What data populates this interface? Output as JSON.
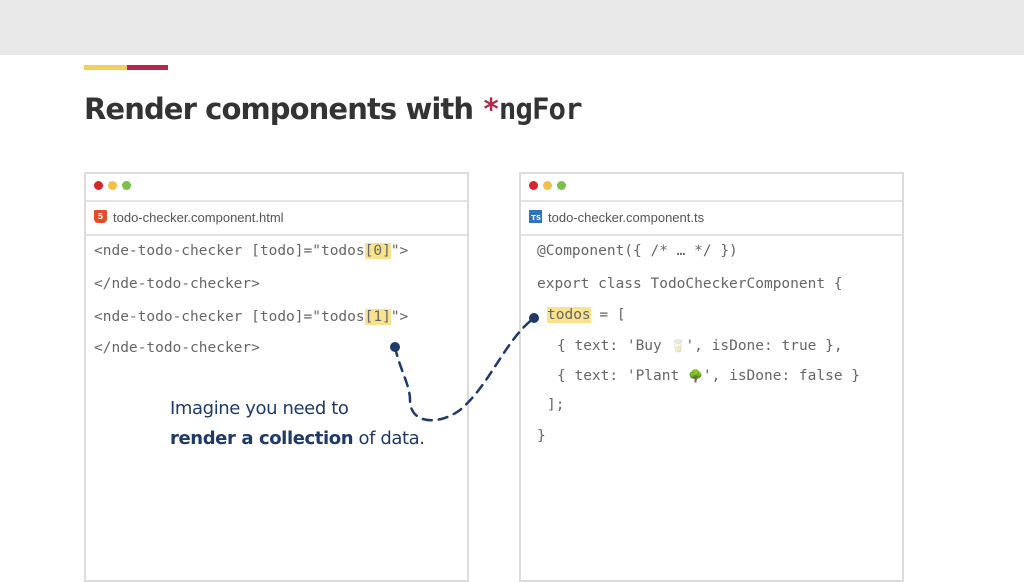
{
  "slide": {
    "title_prefix": "Render components with ",
    "title_star": "*",
    "title_code": "ngFor"
  },
  "left_panel": {
    "filename": "todo-checker.component.html",
    "file_icon": "html5-icon",
    "lines": {
      "l1_a": "<nde-todo-checker [todo]=\"todos",
      "l1_hl": "[0]",
      "l1_b": "\">",
      "l2": "</nde-todo-checker>",
      "l3_a": "<nde-todo-checker [todo]=\"todos",
      "l3_hl": "[1]",
      "l3_b": "\">",
      "l4": "</nde-todo-checker>"
    }
  },
  "right_panel": {
    "filename": "todo-checker.component.ts",
    "file_icon": "typescript-icon",
    "lines": {
      "l1": "@Component({ /* … */ })",
      "l2": "export class TodoCheckerComponent {",
      "l3_hl": "todos",
      "l3_b": " = [",
      "l4_a": "{ text: 'Buy ",
      "l4_emoji": "🥛",
      "l4_b": "', isDone: true },",
      "l5_a": "{ text: 'Plant ",
      "l5_emoji": "🌳",
      "l5_b": "', isDone: false }",
      "l6": "];",
      "l7": "}"
    }
  },
  "annotation": {
    "line1": "Imagine you need to",
    "line2_bold": "render a collection",
    "line2_rest": " of data."
  },
  "colors": {
    "accent_yellow": "#f2cf5a",
    "accent_red": "#b3294d",
    "highlight": "#f8e28b",
    "annotation": "#1f3a68"
  }
}
